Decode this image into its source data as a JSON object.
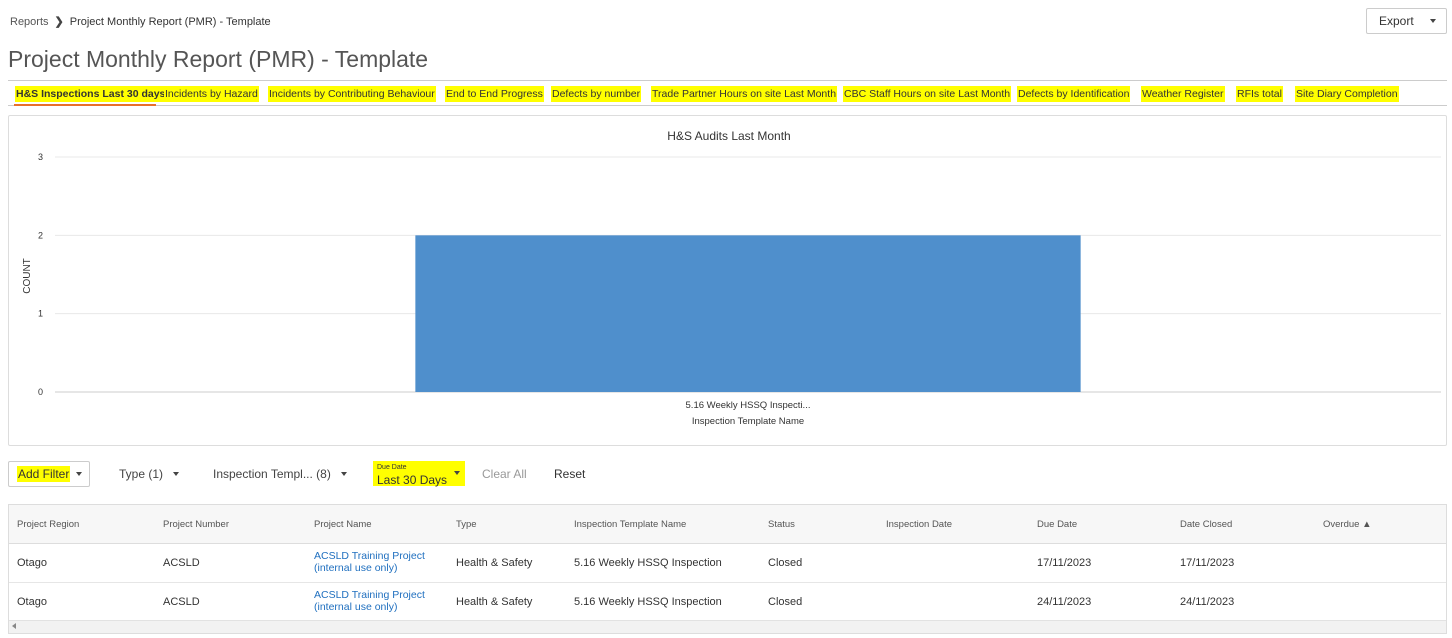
{
  "breadcrumb": {
    "parent": "Reports",
    "separator": "❯",
    "current": "Project Monthly Report (PMR) - Template"
  },
  "export": {
    "label": "Export"
  },
  "page_title": "Project Monthly Report (PMR) - Template",
  "tabs": [
    {
      "label": "H&S Inspections Last 30 days",
      "active": true
    },
    {
      "label": "Incidents by Hazard"
    },
    {
      "label": "Incidents by Contributing Behaviour"
    },
    {
      "label": "End to End Progress"
    },
    {
      "label": "Defects by number"
    },
    {
      "label": "Trade Partner Hours on site Last Month"
    },
    {
      "label": "CBC Staff Hours on site Last Month"
    },
    {
      "label": "Defects by Identification"
    },
    {
      "label": "Weather Register"
    },
    {
      "label": "RFIs total"
    },
    {
      "label": "Site Diary Completion"
    }
  ],
  "chart_data": {
    "type": "bar",
    "title": "H&S Audits Last Month",
    "xlabel": "Inspection Template Name",
    "ylabel": "COUNT",
    "categories": [
      "5.16 Weekly HSSQ Inspecti..."
    ],
    "values": [
      2
    ],
    "yticks": [
      0,
      1,
      2,
      3
    ],
    "ylim": [
      0,
      3
    ],
    "bar_color": "#4f8fcc",
    "grid": true
  },
  "filters": {
    "add_filter": "Add Filter",
    "type": "Type (1)",
    "inspection_template": "Inspection Templ... (8)",
    "due_date_label": "Due Date",
    "due_date_value": "Last 30 Days",
    "clear_all": "Clear All",
    "reset": "Reset"
  },
  "table": {
    "columns": [
      "Project Region",
      "Project Number",
      "Project Name",
      "Type",
      "Inspection Template Name",
      "Status",
      "Inspection Date",
      "Due Date",
      "Date Closed",
      "Overdue ▲"
    ],
    "rows": [
      {
        "region": "Otago",
        "number": "ACSLD",
        "name_line1": "ACSLD Training Project",
        "name_line2": "(internal use only)",
        "type": "Health & Safety",
        "template": "5.16 Weekly HSSQ Inspection",
        "status": "Closed",
        "inspection_date": "",
        "due_date": "17/11/2023",
        "date_closed": "17/11/2023",
        "overdue": ""
      },
      {
        "region": "Otago",
        "number": "ACSLD",
        "name_line1": "ACSLD Training Project",
        "name_line2": "(internal use only)",
        "type": "Health & Safety",
        "template": "5.16 Weekly HSSQ Inspection",
        "status": "Closed",
        "inspection_date": "",
        "due_date": "24/11/2023",
        "date_closed": "24/11/2023",
        "overdue": ""
      }
    ]
  },
  "colors": {
    "highlight": "#ffff00",
    "tab_underline": "#e8702a",
    "link": "#1f6fbf"
  }
}
